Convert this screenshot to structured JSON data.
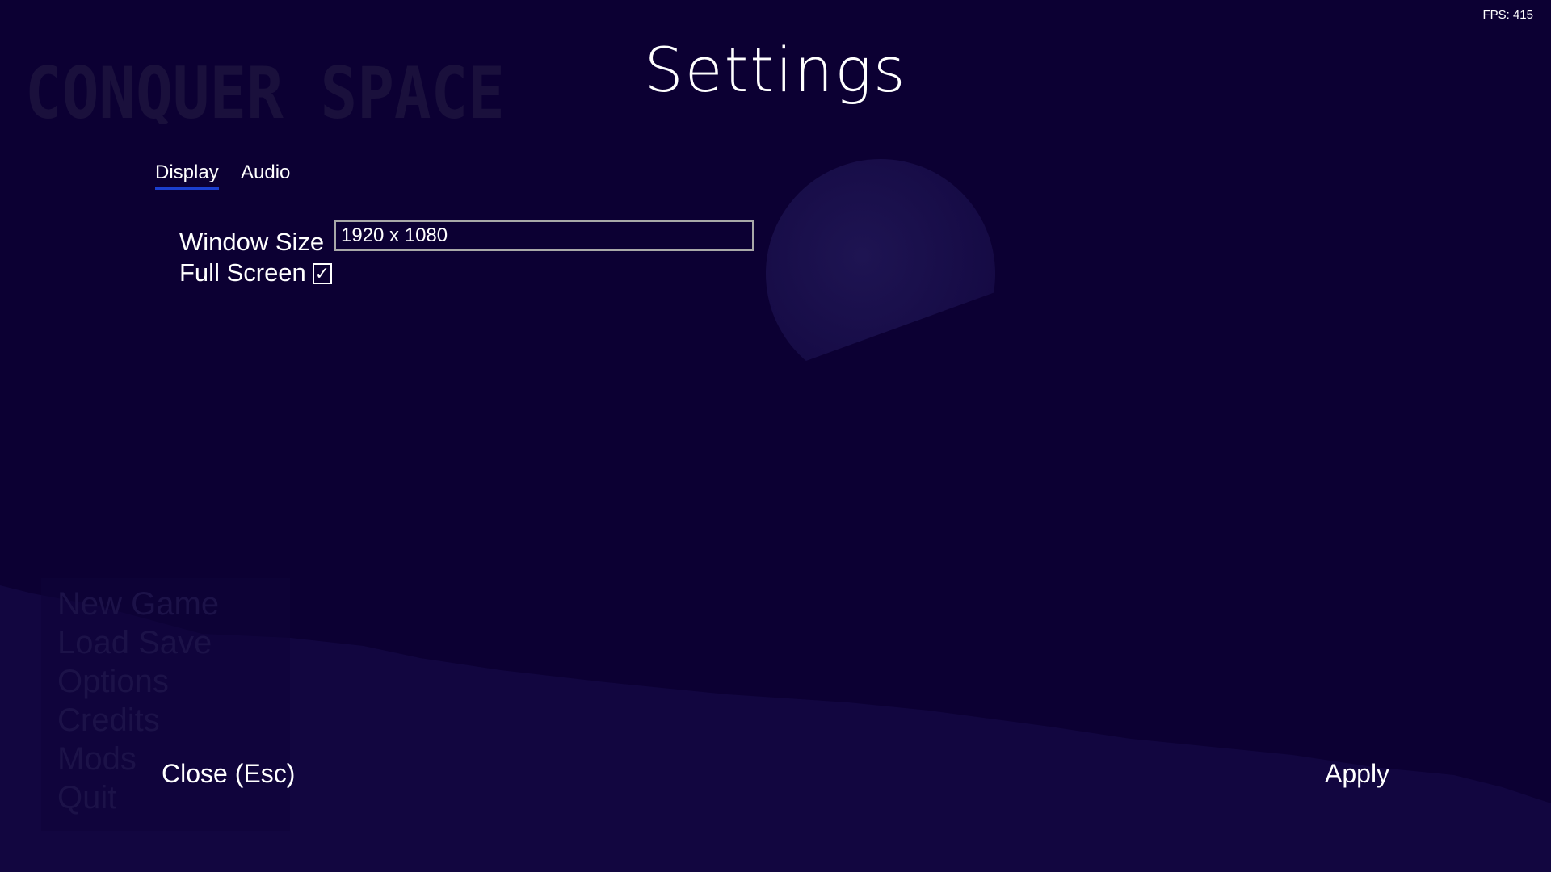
{
  "hud": {
    "fps_label": "FPS: 415"
  },
  "background": {
    "logo_text": "CONQUER SPACE",
    "colors": {
      "sky": "#0c0033",
      "ground": "#120640",
      "logo": "#1a103c",
      "earth": "#1c1150"
    }
  },
  "main_menu": {
    "items": [
      {
        "label": "New Game"
      },
      {
        "label": "Load Save"
      },
      {
        "label": "Options"
      },
      {
        "label": "Credits"
      },
      {
        "label": "Mods"
      },
      {
        "label": "Quit"
      }
    ]
  },
  "settings": {
    "title": "Settings",
    "tabs": [
      {
        "label": "Display",
        "active": true
      },
      {
        "label": "Audio",
        "active": false
      }
    ],
    "display": {
      "window_size_label": "Window Size",
      "window_size_value": "1920 x 1080",
      "fullscreen_label": "Full Screen",
      "fullscreen_checked": true,
      "checkbox_glyph": "✓"
    },
    "close_label": "Close (Esc)",
    "apply_label": "Apply",
    "accent_color": "#1b3fd0"
  }
}
